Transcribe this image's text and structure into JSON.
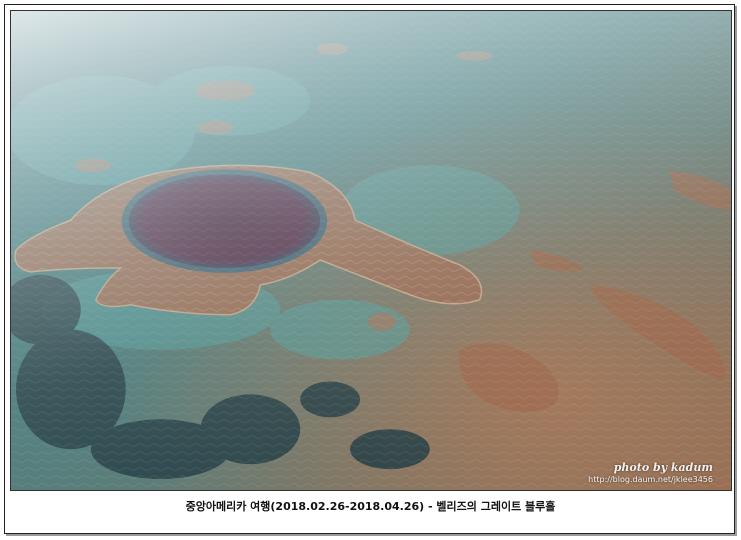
{
  "photo": {
    "watermark_signature": "photo by kadum",
    "watermark_url": "http://blog.daum.net/jklee3456"
  },
  "caption": "중앙아메리카 여행(2018.02.26-2018.04.26) - 벨리즈의 그레이트 블루홀"
}
